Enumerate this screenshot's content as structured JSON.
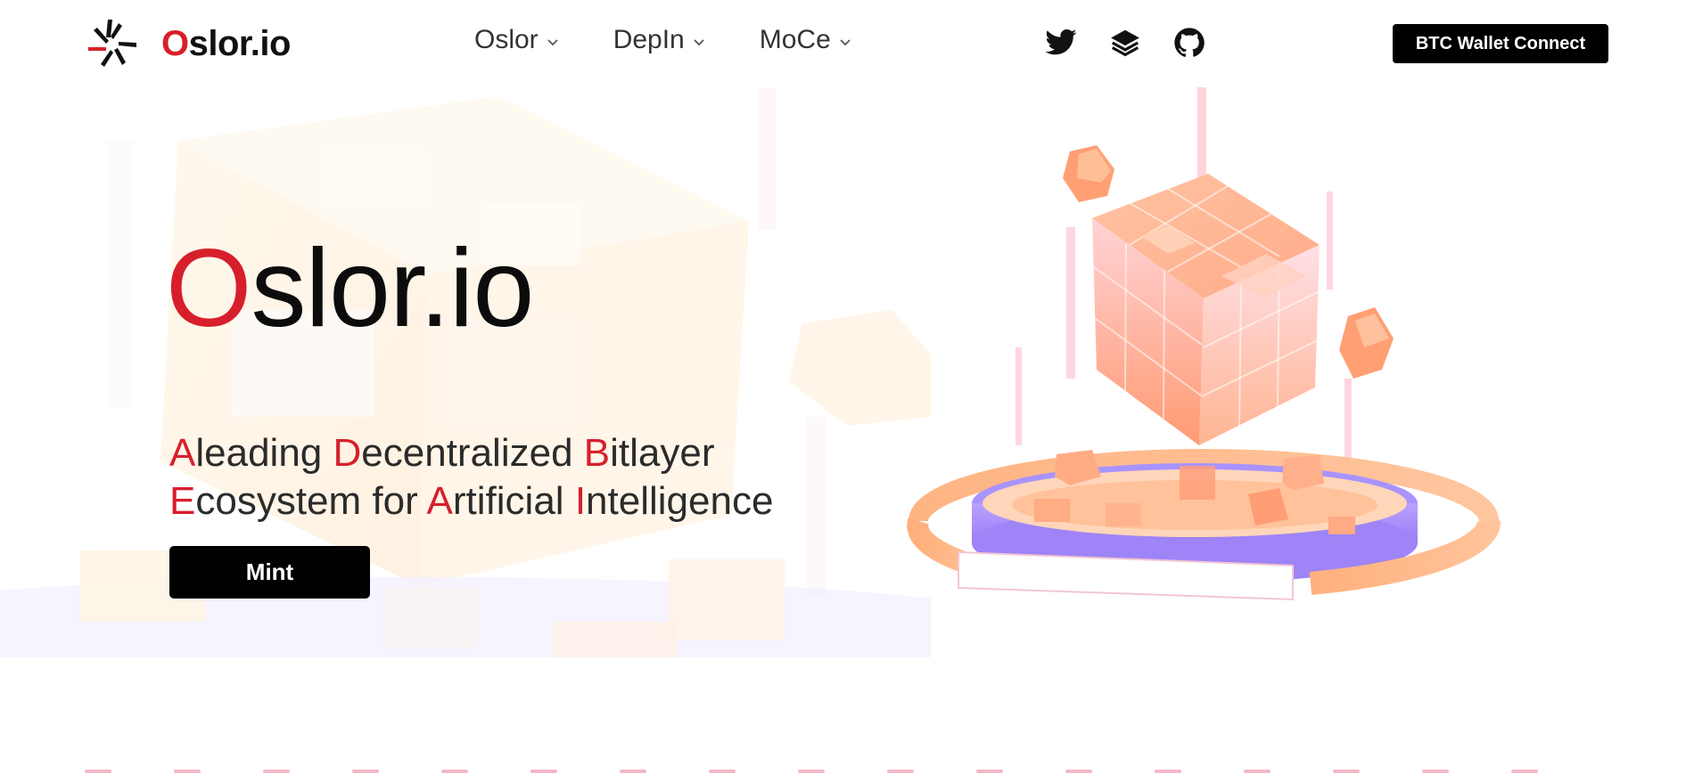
{
  "brand": {
    "name_first": "O",
    "name_rest": "slor.io"
  },
  "nav": [
    {
      "label": "Oslor"
    },
    {
      "label": "DepIn"
    },
    {
      "label": "MoCe"
    }
  ],
  "socials": [
    {
      "icon": "twitter-icon"
    },
    {
      "icon": "layers-icon"
    },
    {
      "icon": "github-icon"
    }
  ],
  "header": {
    "wallet_button": "BTC Wallet Connect"
  },
  "hero": {
    "title_first": "O",
    "title_rest": "slor.io",
    "subtitle": [
      {
        "cap": "A",
        "rest": "leading "
      },
      {
        "cap": "D",
        "rest": "ecentralized "
      },
      {
        "cap": "B",
        "rest": "itlayer"
      },
      {
        "cap": "E",
        "rest": "cosystem for "
      },
      {
        "cap": "A",
        "rest": "rtificial "
      },
      {
        "cap": "I",
        "rest": "ntelligence"
      }
    ],
    "mint_button": "Mint"
  },
  "colors": {
    "accent": "#d71f2c",
    "button": "#000000",
    "cube": "#ffa583",
    "ring": "#a78bff"
  }
}
